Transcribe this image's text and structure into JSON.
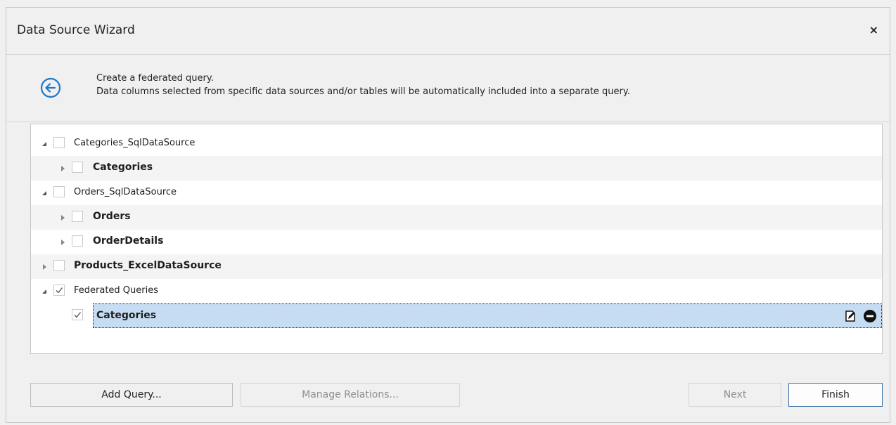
{
  "window": {
    "title": "Data Source Wizard",
    "close_label": "×"
  },
  "header": {
    "line1": "Create a federated query.",
    "line2": "Data columns selected from specific data sources and/or tables will be automatically included into a separate query."
  },
  "tree": {
    "items": [
      {
        "label": "Categories_SqlDataSource",
        "checked": false
      },
      {
        "label": "Categories",
        "checked": false
      },
      {
        "label": "Orders_SqlDataSource",
        "checked": false
      },
      {
        "label": "Orders",
        "checked": false
      },
      {
        "label": "OrderDetails",
        "checked": false
      },
      {
        "label": "Products_ExcelDataSource",
        "checked": false
      },
      {
        "label": "Federated Queries",
        "checked": true
      },
      {
        "label": "Categories",
        "checked": true
      }
    ]
  },
  "buttons": {
    "add_query": "Add Query...",
    "manage_relations": "Manage Relations...",
    "next": "Next",
    "finish": "Finish"
  },
  "icons": [
    "back-arrow-icon",
    "close-icon",
    "edit-query-icon",
    "remove-query-icon",
    "expand-icon",
    "collapse-icon",
    "checkmark-icon"
  ],
  "colors": {
    "accent": "#1e78c8",
    "selection": "#c6dcf2"
  }
}
